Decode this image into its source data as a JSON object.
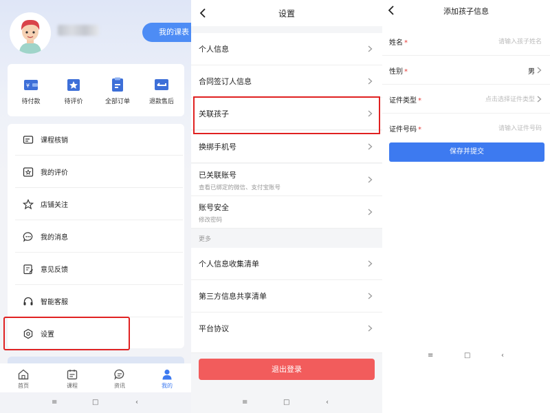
{
  "profile": {
    "course_button": "我的课表",
    "quick_actions": [
      {
        "label": "待付款",
        "icon": "wallet-icon"
      },
      {
        "label": "待评价",
        "icon": "star-badge-icon"
      },
      {
        "label": "全部订单",
        "icon": "order-list-icon"
      },
      {
        "label": "退款售后",
        "icon": "refund-icon"
      }
    ],
    "menu": [
      {
        "label": "课程核销",
        "icon": "ticket-icon"
      },
      {
        "label": "我的评价",
        "icon": "review-icon"
      },
      {
        "label": "店铺关注",
        "icon": "star-outline-icon"
      },
      {
        "label": "我的消息",
        "icon": "message-icon"
      },
      {
        "label": "意见反馈",
        "icon": "feedback-icon"
      },
      {
        "label": "智能客服",
        "icon": "headset-icon"
      },
      {
        "label": "设置",
        "icon": "gear-icon"
      }
    ],
    "tabs": [
      {
        "label": "首页",
        "icon": "home-icon",
        "active": false
      },
      {
        "label": "课程",
        "icon": "calendar-icon",
        "active": false
      },
      {
        "label": "资讯",
        "icon": "news-icon",
        "active": false
      },
      {
        "label": "我的",
        "icon": "user-icon",
        "active": true
      }
    ]
  },
  "settings": {
    "title": "设置",
    "rows": [
      {
        "label": "个人信息"
      },
      {
        "label": "合同签订人信息"
      },
      {
        "label": "关联孩子"
      },
      {
        "label": "换绑手机号"
      },
      {
        "label": "已关联账号",
        "sub": "查看已绑定的微信、支付宝账号"
      },
      {
        "label": "账号安全",
        "sub": "修改密码"
      }
    ],
    "section_more": "更多",
    "more_rows": [
      {
        "label": "个人信息收集清单"
      },
      {
        "label": "第三方信息共享清单"
      },
      {
        "label": "平台协议"
      }
    ],
    "logout": "退出登录"
  },
  "child_form": {
    "title": "添加孩子信息",
    "fields": [
      {
        "label": "姓名",
        "required": "*",
        "placeholder": "请输入孩子姓名"
      },
      {
        "label": "性别",
        "required": "*",
        "value": "男"
      },
      {
        "label": "证件类型",
        "required": "*",
        "placeholder": "点击选择证件类型"
      },
      {
        "label": "证件号码",
        "required": "*",
        "placeholder": "请输入证件号码"
      }
    ],
    "submit": "保存并提交"
  },
  "system_nav": {
    "menu": "≡",
    "home": "□",
    "back": "‹"
  },
  "colors": {
    "primary": "#3d7af0",
    "danger": "#f25c5c",
    "highlight": "#e02020"
  }
}
